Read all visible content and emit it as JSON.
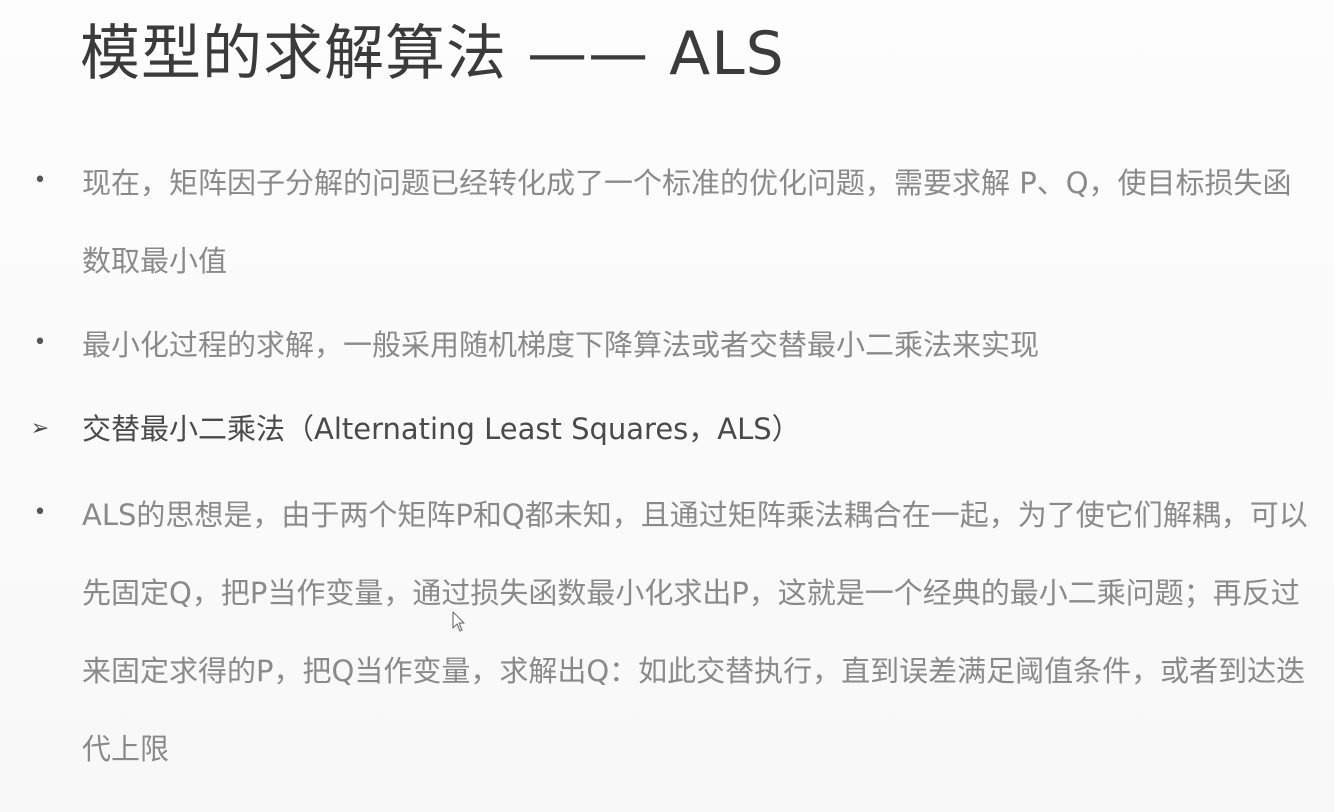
{
  "slide": {
    "title": "模型的求解算法 —— ALS",
    "bullets": [
      {
        "marker": "•",
        "text": "现在，矩阵因子分解的问题已经转化成了一个标准的优化问题，需要求解 P、Q，使目标损失函数取最小值"
      },
      {
        "marker": "•",
        "text": "最小化过程的求解，一般采用随机梯度下降算法或者交替最小二乘法来实现"
      },
      {
        "marker": "➢",
        "text": "交替最小二乘法（Alternating Least Squares，ALS）"
      },
      {
        "marker": "•",
        "text": "ALS的思想是，由于两个矩阵P和Q都未知，且通过矩阵乘法耦合在一起，为了使它们解耦，可以先固定Q，把P当作变量，通过损失函数最小化求出P，这就是一个经典的最小二乘问题；再反过来固定求得的P，把Q当作变量，求解出Q：如此交替执行，直到误差满足阈值条件，或者到达迭代上限"
      }
    ]
  },
  "cursor_icon": "mouse-pointer-icon",
  "colors": {
    "title": "#3b3b3b",
    "body_text": "#8a8a8a",
    "emphasis_text": "#4a4a4a",
    "background": "#fbfbfb"
  }
}
